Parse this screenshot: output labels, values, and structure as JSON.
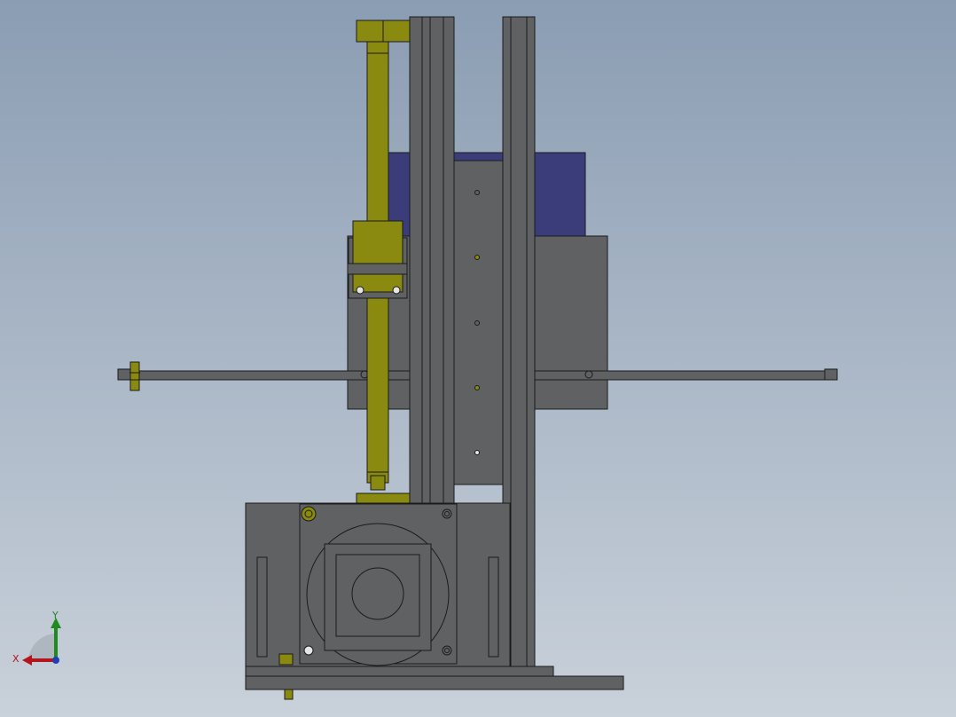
{
  "colors": {
    "background_top": "#8b9db3",
    "background_bottom": "#c9d1da",
    "frame_gray": "#5f6163",
    "frame_dark": "#4e5052",
    "edge": "#1b1b1b",
    "screw_olive": "#8a8a10",
    "screw_olive_dark": "#6f6f0c",
    "panel_blue": "#3a3d7a",
    "hole_white": "#e6e6e6",
    "axis_x": "#b4141a",
    "axis_y": "#1f8a1f",
    "axis_z": "#1f3fb4"
  },
  "viewport": {
    "name": "cad-model-viewport",
    "view": "front"
  },
  "triad": {
    "x_label": "X",
    "y_label": "Y"
  }
}
